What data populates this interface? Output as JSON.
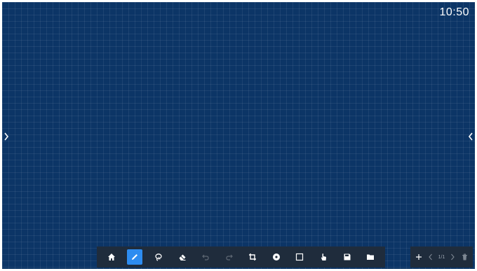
{
  "status": {
    "clock": "10:50"
  },
  "colors": {
    "board": "#0c3566",
    "toolbar": "#1f2c3c",
    "active": "#2d8cf0"
  },
  "edges": {
    "left_icon": "chevron-right-icon",
    "right_icon": "chevron-left-icon"
  },
  "toolbar": {
    "tools": [
      {
        "icon": "home-icon",
        "active": false
      },
      {
        "icon": "pen-icon",
        "active": true
      },
      {
        "icon": "lasso-select-icon",
        "active": false
      },
      {
        "icon": "eraser-icon",
        "active": false
      },
      {
        "icon": "undo-icon",
        "active": false
      },
      {
        "icon": "redo-icon",
        "active": false
      },
      {
        "icon": "crop-icon",
        "active": false
      },
      {
        "icon": "background-color-icon",
        "active": false
      },
      {
        "icon": "square-icon",
        "active": false
      },
      {
        "icon": "hand-pointer-icon",
        "active": false
      },
      {
        "icon": "save-icon",
        "active": false
      },
      {
        "icon": "folder-icon",
        "active": false
      }
    ]
  },
  "pager": {
    "page_indicator": "1/1",
    "icons": [
      "add-page-icon",
      "previous-page-icon",
      "next-page-icon",
      "delete-page-icon"
    ]
  }
}
